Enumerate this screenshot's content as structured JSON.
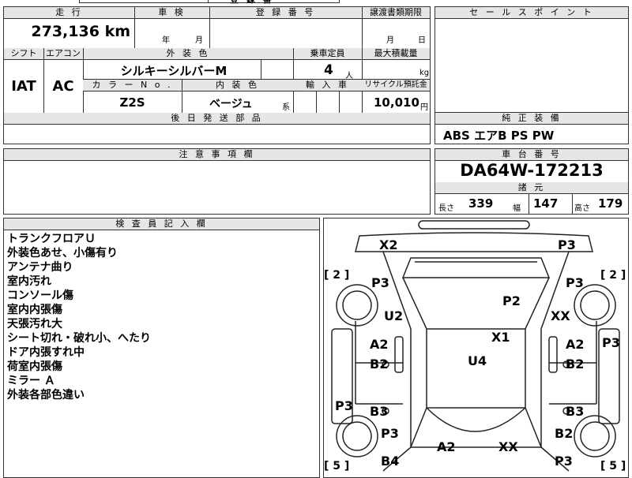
{
  "top_partial": "登 録 番",
  "labels": {
    "mileage": "走 行",
    "inspection": "車 検",
    "reg_no": "登 録 番 号",
    "transfer": "譲渡書類期限",
    "sales_point": "セ ー ル ス ポ イ ン ト",
    "shift": "シフト",
    "aircon": "エアコン",
    "ext_color": "外 装 色",
    "capacity": "乗車定員",
    "max_load": "最大積載量",
    "color_no": "カ ラ ー N o .",
    "int_color": "内 装 色",
    "import": "輸 入 車",
    "recycle": "リサイクル預託金",
    "later_parts": "後 日 発 送 部 品",
    "genuine_equip": "純 正 装 備",
    "notes": "注 意 事 項 欄",
    "chassis_no": "車 台 番 号",
    "specs": "諸 元",
    "inspector": "検 査 員 記 入 欄"
  },
  "values": {
    "mileage": "273,136",
    "mileage_unit": "km",
    "insp_year": "年",
    "insp_month": "月",
    "transfer_month": "月",
    "transfer_day": "日",
    "shift": "IAT",
    "aircon": "AC",
    "ext_color": "シルキーシルバーM",
    "capacity": "4",
    "capacity_unit": "人",
    "load_unit": "kg",
    "color_no": "Z2S",
    "int_color": "ベージュ",
    "int_color_suffix": "系",
    "recycle": "10,010",
    "recycle_unit": "円",
    "genuine_equip": "ABS エアB PS PW",
    "chassis_no": "DA64W-172213",
    "length_label": "長さ",
    "length": "339",
    "width_label": "幅",
    "width": "147",
    "height_label": "高さ",
    "height": "179"
  },
  "inspector_notes": [
    "トランクフロアＵ",
    "外装色あせ、小傷有り",
    "アンテナ曲り",
    "室内汚れ",
    "コンソール傷",
    "室内内張傷",
    "天張汚れ大",
    "シート切れ・破れ小、へたり",
    "ドア内張すれ中",
    "荷室内張傷",
    "ミラー Ａ",
    "外装各部色違い"
  ],
  "diagram": {
    "left_bracket_top": "[ 2 ]",
    "right_bracket_top": "[ 2 ]",
    "left_bracket_bottom": "[ 5 ]",
    "right_bracket_bottom": "[ 5 ]",
    "marks": {
      "m1": "X2",
      "m2": "P3",
      "m3": "P3",
      "m4": "P3",
      "m5": "P2",
      "m6": "U2",
      "m7": "XX",
      "m8": "X1",
      "m9": "P3",
      "m10": "A2",
      "m11": "A2",
      "m12": "U4",
      "m13": "B2",
      "m14": "B2",
      "m15": "P3",
      "m16": "B3",
      "m17": "B3",
      "m18": "P3",
      "m19": "B2",
      "m20": "A2",
      "m21": "XX",
      "m22": "B4",
      "m23": "P3"
    }
  }
}
